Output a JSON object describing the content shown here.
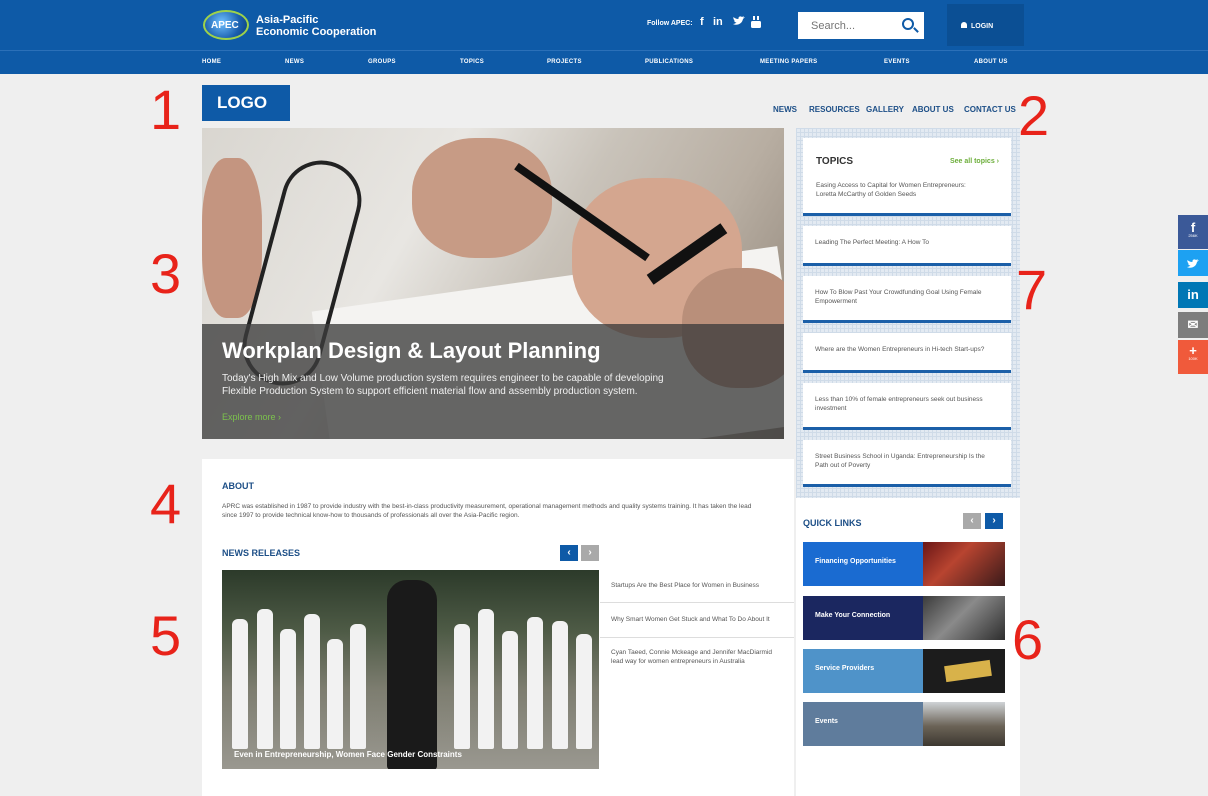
{
  "header": {
    "org_badge": "APEC",
    "org_name_line1": "Asia-Pacific",
    "org_name_line2": "Economic Cooperation",
    "follow_label": "Follow APEC:",
    "social": [
      "f",
      "in",
      "t",
      "yt"
    ],
    "search_placeholder": "Search...",
    "login_label": "LOGIN"
  },
  "main_nav": [
    "HOME",
    "NEWS",
    "GROUPS",
    "TOPICS",
    "PROJECTS",
    "PUBLICATIONS",
    "MEETING PAPERS",
    "EVENTS",
    "ABOUT US"
  ],
  "site": {
    "logo": "LOGO",
    "sub_nav": [
      "NEWS",
      "RESOURCES",
      "GALLERY",
      "ABOUT US",
      "CONTACT US"
    ]
  },
  "hero": {
    "title": "Workplan Design & Layout Planning",
    "text": "Today's High Mix and Low Volume production system requires engineer to be capable of developing Flexible Production System to support efficient material flow and assembly production system.",
    "link": "Explore more  ›"
  },
  "topics": {
    "title": "TOPICS",
    "see_all": "See all topics  ›",
    "items": [
      "Easing Access to Capital for Women Entrepreneurs: Loretta McCarthy of Golden Seeds",
      "Leading The Perfect Meeting: A How To",
      "How To Blow Past Your Crowdfunding Goal Using Female Empowerment",
      "Where are the Women Entrepreneurs in Hi-tech Start-ups?",
      "Less than 10% of female entrepreneurs seek out business investment",
      "Street Business School in Uganda: Entrepreneurship Is the Path out of Poverty"
    ]
  },
  "about": {
    "title": "ABOUT",
    "text": "APRC was established in 1987 to provide industry with the best-in-class productivity measurement, operational management methods and quality systems training. It has taken the lead since 1997 to provide technical know-how to thousands of professionals all over the Asia-Pacific region."
  },
  "news": {
    "title": "NEWS RELEASES",
    "prev": "‹",
    "next": "›",
    "image_caption": "Even in Entrepreneurship, Women Face Gender Constraints",
    "items": [
      "Startups Are the Best Place for Women in Business",
      "Why Smart Women Get Stuck and What To Do About It",
      "Cyan Taeed, Connie Mckeage and Jennifer MacDiarmid lead way for women entrepreneurs in Australia"
    ]
  },
  "quick_links": {
    "title": "QUICK LINKS",
    "prev": "‹",
    "next": "›",
    "items": [
      {
        "label": "Financing Opportunities",
        "color": "#1a6bd1"
      },
      {
        "label": "Make Your Connection",
        "color": "#1b2760"
      },
      {
        "label": "Service Providers",
        "color": "#4f93c9"
      },
      {
        "label": "Events",
        "color": "#5f7c9c"
      }
    ]
  },
  "annotations": [
    "1",
    "2",
    "3",
    "4",
    "5",
    "6",
    "7"
  ],
  "share_bar": [
    {
      "icon": "f",
      "count": "256K",
      "color": "#3b5998"
    },
    {
      "icon": "t",
      "count": "",
      "color": "#1da1f2"
    },
    {
      "icon": "in",
      "count": "",
      "color": "#0077b5"
    },
    {
      "icon": "✉",
      "count": "",
      "color": "#7d7d7d"
    },
    {
      "icon": "+",
      "count": "100K",
      "color": "#f05a3b"
    }
  ],
  "colors": {
    "brand": "#0e5aa7",
    "accent_green": "#6cae3a",
    "annotation_red": "#e8231a"
  }
}
